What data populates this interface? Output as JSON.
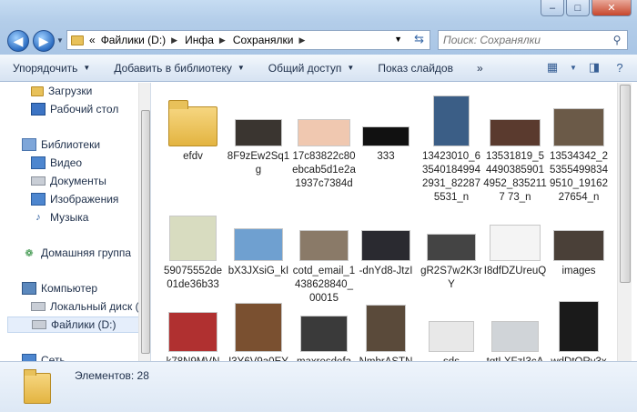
{
  "address": {
    "overflow": "«",
    "crumbs": [
      "Файлики (D:)",
      "Инфа",
      "Сохранялки"
    ]
  },
  "search": {
    "placeholder": "Поиск: Сохранялки"
  },
  "toolbar": {
    "items": [
      "Упорядочить",
      "Добавить в библиотеку",
      "Общий доступ",
      "Показ слайдов"
    ],
    "more": "»"
  },
  "nav": {
    "downloads": "Загрузки",
    "desktop": "Рабочий стол",
    "libraries": "Библиотеки",
    "video": "Видео",
    "documents": "Документы",
    "images": "Изображения",
    "music": "Музыка",
    "homegroup": "Домашняя группа",
    "computer": "Компьютер",
    "local_disk": "Локальный диск (С",
    "files_disk": "Файлики (D:)",
    "network": "Сеть"
  },
  "files": [
    {
      "name": "efdv",
      "kind": "folder"
    },
    {
      "name": "8F9zEw2Sq1g",
      "kind": "image",
      "color": "#3a3530"
    },
    {
      "name": "17c83822c80ebcab5d1e2a1937c7384d",
      "kind": "image",
      "color": "#f0c8b0"
    },
    {
      "name": "333",
      "kind": "image",
      "color": "#111111"
    },
    {
      "name": "13423010_63540184994 2931_822875531_n",
      "kind": "image",
      "color": "#3b5e86"
    },
    {
      "name": "13531819_54490385901 4952_8352117 73_n",
      "kind": "image",
      "color": "#5a3a2e"
    },
    {
      "name": "13534342_253554998349510_1916227654_n",
      "kind": "image",
      "color": "#6b5a48"
    },
    {
      "name": "59075552de01de36b33",
      "kind": "image",
      "color": "#d8dcc0"
    },
    {
      "name": "bX3JXsiG_kI",
      "kind": "image",
      "color": "#6fa0d0"
    },
    {
      "name": "cotd_email_1438628840_00015",
      "kind": "image",
      "color": "#8a7a68"
    },
    {
      "name": "-dnYd8-JtzI",
      "kind": "image",
      "color": "#2a2a30"
    },
    {
      "name": "gR2S7w2K3rY",
      "kind": "image",
      "color": "#444444"
    },
    {
      "name": "I8dfDZUreuQ",
      "kind": "image",
      "color": "#f4f4f4"
    },
    {
      "name": "images",
      "kind": "image",
      "color": "#4a4038"
    },
    {
      "name": "k78N9MVN",
      "kind": "image",
      "color": "#b03030"
    },
    {
      "name": "I3Y6V9a0EY",
      "kind": "image",
      "color": "#7a5030"
    },
    {
      "name": "maxresdefa",
      "kind": "image",
      "color": "#3a3a3a"
    },
    {
      "name": "NmbrASTN",
      "kind": "image",
      "color": "#5a4a3a"
    },
    {
      "name": "sds",
      "kind": "image",
      "color": "#e8e8e8"
    },
    {
      "name": "tqtLXFzI3cA",
      "kind": "image",
      "color": "#d0d4d8"
    },
    {
      "name": "wdDtQRy3x",
      "kind": "image",
      "color": "#1a1a1a"
    }
  ],
  "status": {
    "count_text": "Элементов: 28"
  }
}
